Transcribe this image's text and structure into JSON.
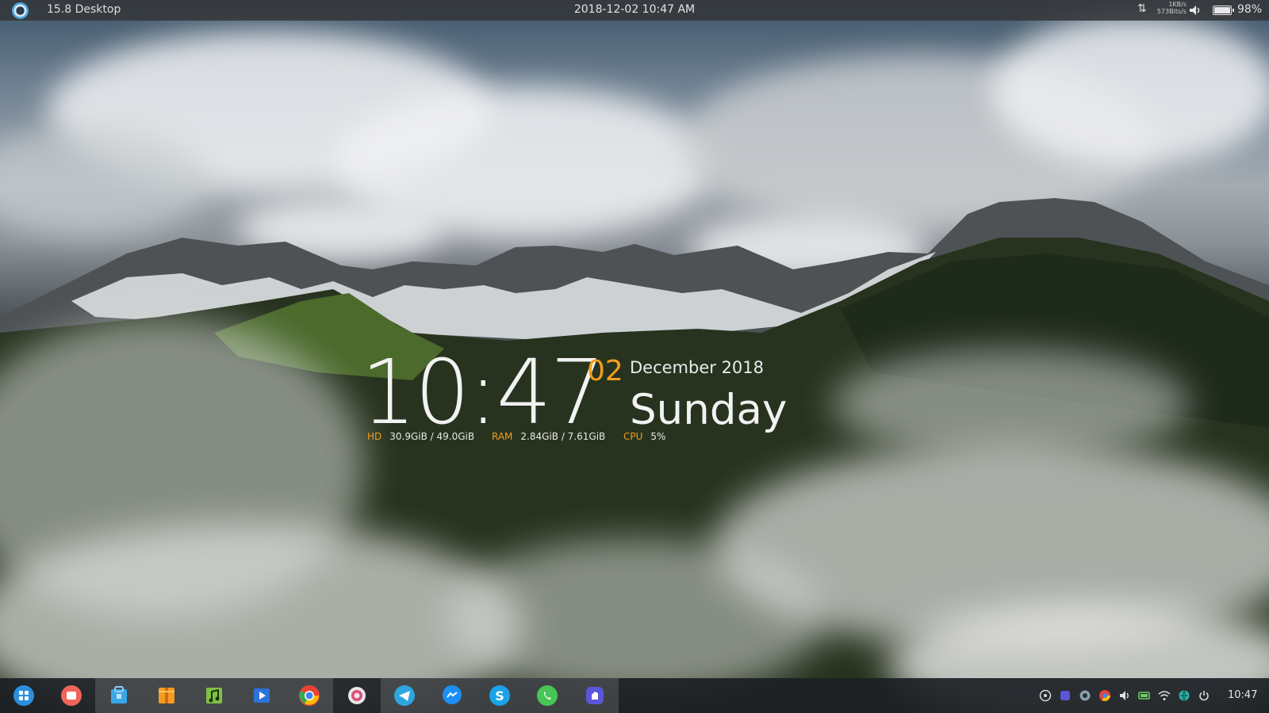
{
  "top_panel": {
    "title": "15.8 Desktop",
    "datetime": "2018-12-02 10:47 AM",
    "net_up": "1KB/s",
    "net_down": "573Bits/s",
    "battery_percent": "98%",
    "icons": [
      "deepin-logo-icon",
      "network-speed-icon",
      "volume-icon",
      "battery-icon"
    ]
  },
  "desklet": {
    "time": "10:47",
    "day_number": "02",
    "month_year": "December 2018",
    "weekday": "Sunday",
    "stats": [
      {
        "label": "HD",
        "value": "30.9GiB / 49.0GiB"
      },
      {
        "label": "RAM",
        "value": "2.84GiB / 7.61GiB"
      },
      {
        "label": "CPU",
        "value": "5%"
      }
    ],
    "accent_color": "#f29f1b"
  },
  "taskbar": {
    "apps": [
      {
        "name": "launcher-icon",
        "color": "#2a8fe0"
      },
      {
        "name": "screen-recorder-icon",
        "color": "#f0645a"
      },
      {
        "name": "app-store-icon",
        "color": "#3aa7e8"
      },
      {
        "name": "file-archiver-icon",
        "color": "#f49b24"
      },
      {
        "name": "music-player-icon",
        "color": "#7dc242"
      },
      {
        "name": "video-player-icon",
        "color": "#2a73d8"
      },
      {
        "name": "chrome-icon",
        "color": "#ea4335"
      },
      {
        "name": "settings-icon",
        "color": "#e8e8e8"
      },
      {
        "name": "telegram-icon",
        "color": "#2ea6e0"
      },
      {
        "name": "messenger-icon",
        "color": "#1c8ef5"
      },
      {
        "name": "skype-icon",
        "color": "#1aa3e8"
      },
      {
        "name": "whatsapp-icon",
        "color": "#45c655"
      },
      {
        "name": "app-icon",
        "color": "#5b55d9"
      }
    ],
    "tray_icons": [
      "whatsapp-tray-icon",
      "app-tray-icon",
      "sync-tray-icon",
      "chrome-tray-icon",
      "volume-tray-icon",
      "battery-tray-icon",
      "wifi-tray-icon",
      "globe-tray-icon",
      "power-tray-icon"
    ],
    "clock": "10:47"
  }
}
